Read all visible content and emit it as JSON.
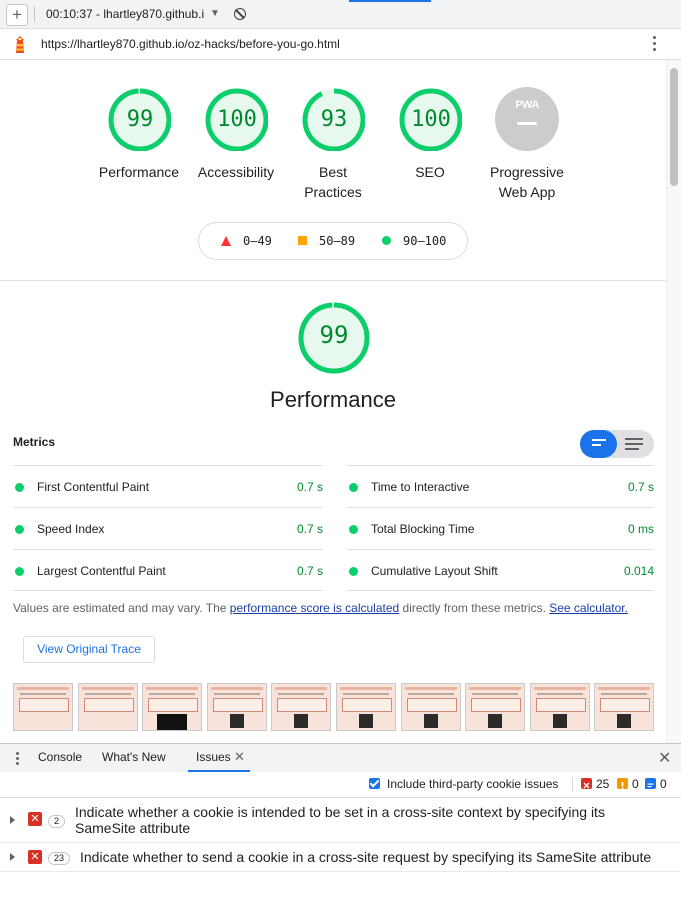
{
  "toolbar": {
    "new_label": "+",
    "session": "00:10:37 - lhartley870.github.i",
    "caret": "▼",
    "block_icon": "block-icon"
  },
  "address": {
    "url": "https://lhartley870.github.io/oz-hacks/before-you-go.html",
    "menu_icon": "kebab-icon"
  },
  "scores": [
    {
      "value": "99",
      "label1": "Performance",
      "label2": "",
      "fraction": 0.99,
      "color": "#0cce6b"
    },
    {
      "value": "100",
      "label1": "Accessibility",
      "label2": "",
      "fraction": 1.0,
      "color": "#0cce6b"
    },
    {
      "value": "93",
      "label1": "Best",
      "label2": "Practices",
      "fraction": 0.93,
      "color": "#0cce6b"
    },
    {
      "value": "100",
      "label1": "SEO",
      "label2": "",
      "fraction": 1.0,
      "color": "#0cce6b"
    },
    {
      "value": "PWA",
      "label1": "Progressive",
      "label2": "Web App",
      "fraction": 0,
      "color": "#bdbdbd"
    }
  ],
  "legend": {
    "fail": "0–49",
    "average": "50–89",
    "pass": "90–100",
    "colors": {
      "fail": "#ff3333",
      "average": "#ffa400",
      "pass": "#0cce6b"
    }
  },
  "performance": {
    "score": "99",
    "fraction": 0.99,
    "title": "Performance",
    "metrics_heading": "Metrics",
    "metrics": [
      {
        "name": "First Contentful Paint",
        "value": "0.7 s"
      },
      {
        "name": "Time to Interactive",
        "value": "0.7 s"
      },
      {
        "name": "Speed Index",
        "value": "0.7 s"
      },
      {
        "name": "Total Blocking Time",
        "value": "0 ms"
      },
      {
        "name": "Largest Contentful Paint",
        "value": "0.7 s"
      },
      {
        "name": "Cumulative Layout Shift",
        "value": "0.014"
      }
    ],
    "note_pre": "Values are estimated and may vary. The ",
    "note_link": "performance score is calculated",
    "note_mid": " directly from these metrics. ",
    "note_link2": "See calculator.",
    "trace_button": "View Original Trace"
  },
  "drawer": {
    "tabs": [
      "Console",
      "What's New",
      "Issues"
    ],
    "active_tab": "Issues",
    "include_label": "Include third-party cookie issues",
    "include_checked": true,
    "counts": {
      "errors": "25",
      "warnings": "0",
      "info": "0"
    },
    "issues": [
      {
        "count": "2",
        "title": "Indicate whether a cookie is intended to be set in a cross-site context by specifying its SameSite attribute"
      },
      {
        "count": "23",
        "title": "Indicate whether to send a cookie in a cross-site request by specifying its SameSite attribute"
      }
    ]
  },
  "colors": {
    "accent": "#1a73e8",
    "pass": "#0cce6b",
    "pass_text": "#008a2e",
    "error": "#d93025",
    "warning": "#f29900",
    "info": "#1a73e8"
  }
}
